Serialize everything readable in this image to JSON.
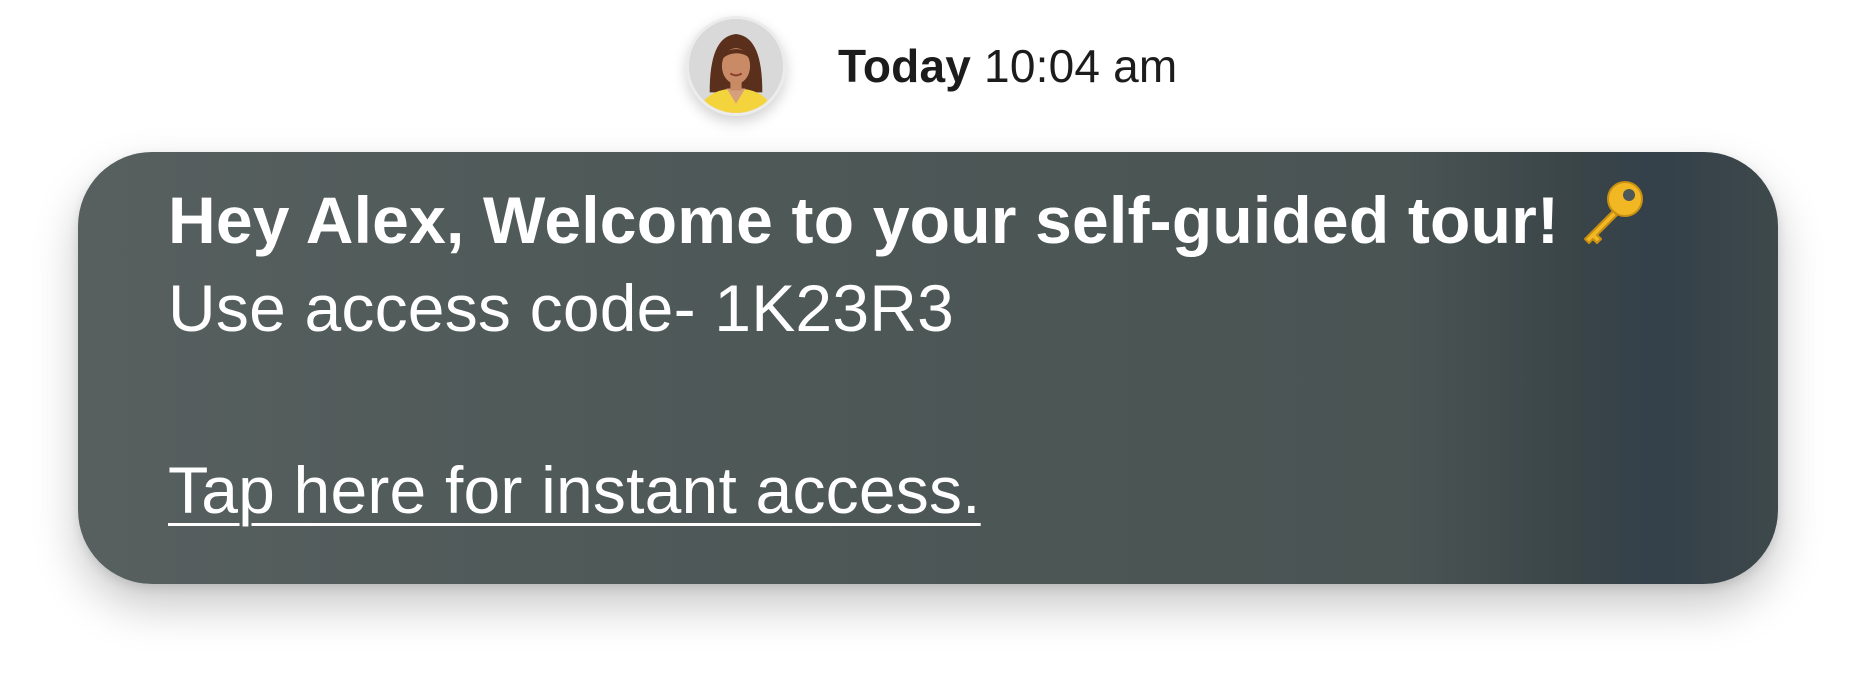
{
  "header": {
    "avatar_alt": "Sender avatar",
    "timestamp_day": "Today",
    "timestamp_time": "10:04 am"
  },
  "message": {
    "greeting": "Hey Alex, Welcome to your self-guided tour!",
    "greeting_icon": "key-icon",
    "access_line": "Use access code- 1K23R3",
    "link_text": "Tap here for instant access."
  },
  "colors": {
    "bubble": "#4e5857",
    "text": "#ffffff",
    "timestamp": "#1c1c1c",
    "key": "#f2b824"
  }
}
